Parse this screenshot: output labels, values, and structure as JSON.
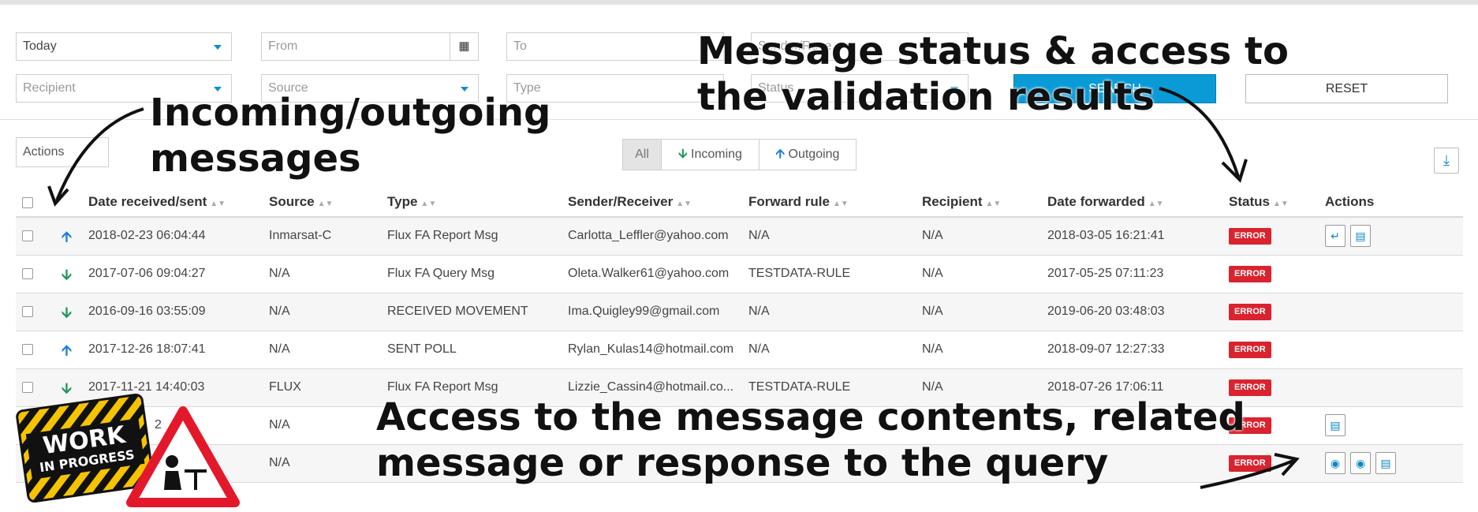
{
  "filters": {
    "period": "Today",
    "from_placeholder": "From",
    "to_placeholder": "To",
    "sender_placeholder": "Sender/Rece...",
    "recipient_placeholder": "Recipient",
    "source_placeholder": "Source",
    "type_placeholder": "Type",
    "status_placeholder": "Status",
    "search_label": "SEARCH",
    "reset_label": "RESET"
  },
  "toolbar": {
    "actions_label": "Actions",
    "segments": [
      "All",
      "Incoming",
      "Outgoing"
    ]
  },
  "table": {
    "columns": [
      "Date received/sent",
      "Source",
      "Type",
      "Sender/Receiver",
      "Forward rule",
      "Recipient",
      "Date forwarded",
      "Status",
      "Actions"
    ],
    "rows": [
      {
        "dir": "out",
        "date": "2018-02-23 06:04:44",
        "source": "Inmarsat-C",
        "type": "Flux FA Report Msg",
        "sender": "Carlotta_Leffler@yahoo.com",
        "rule": "N/A",
        "recipient": "N/A",
        "forwarded": "2018-03-05 16:21:41",
        "status": "ERROR"
      },
      {
        "dir": "in",
        "date": "2017-07-06 09:04:27",
        "source": "N/A",
        "type": "Flux FA Query Msg",
        "sender": "Oleta.Walker61@yahoo.com",
        "rule": "TESTDATA-RULE",
        "recipient": "N/A",
        "forwarded": "2017-05-25 07:11:23",
        "status": "ERROR"
      },
      {
        "dir": "in",
        "date": "2016-09-16 03:55:09",
        "source": "N/A",
        "type": "RECEIVED MOVEMENT",
        "sender": "Ima.Quigley99@gmail.com",
        "rule": "N/A",
        "recipient": "N/A",
        "forwarded": "2019-06-20 03:48:03",
        "status": "ERROR"
      },
      {
        "dir": "out",
        "date": "2017-12-26 18:07:41",
        "source": "N/A",
        "type": "SENT POLL",
        "sender": "Rylan_Kulas14@hotmail.com",
        "rule": "N/A",
        "recipient": "N/A",
        "forwarded": "2018-09-07 12:27:33",
        "status": "ERROR"
      },
      {
        "dir": "in",
        "date": "2017-11-21 14:40:03",
        "source": "FLUX",
        "type": "Flux FA Report Msg",
        "sender": "Lizzie_Cassin4@hotmail.co...",
        "rule": "TESTDATA-RULE",
        "recipient": "N/A",
        "forwarded": "2018-07-26 17:06:11",
        "status": "ERROR"
      },
      {
        "dir": "",
        "date": "2",
        "source": "N/A",
        "type": "",
        "sender": "",
        "rule": "",
        "recipient": "",
        "forwarded": "",
        "status": "ERROR"
      },
      {
        "dir": "",
        "date": "",
        "source": "N/A",
        "type": "",
        "sender": "",
        "rule": "",
        "recipient": "",
        "forwarded": "",
        "status": "ERROR"
      }
    ]
  },
  "annotations": {
    "direction": [
      "Incoming/outgoing",
      "messages"
    ],
    "status": [
      "Message status & access to",
      "the validation results"
    ],
    "contents": [
      "Access to the message contents, related",
      "message or response to the query"
    ]
  },
  "sign": {
    "line1": "WORK",
    "line2": "IN PROGRESS"
  },
  "colors": {
    "accent": "#0a9ad6",
    "error": "#d9232e",
    "outgoing": "#1a7fe0",
    "incoming": "#1a9a5a"
  }
}
